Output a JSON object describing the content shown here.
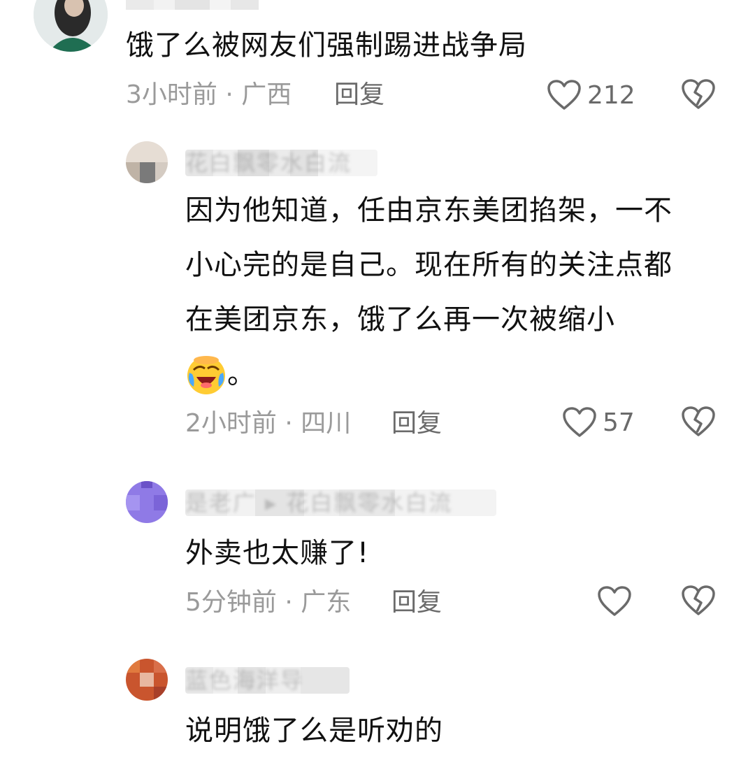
{
  "comments": [
    {
      "text": "饿了么被网友们强制踢进战争局",
      "time": "3小时前",
      "location": "广西",
      "reply_label": "回复",
      "likes": "212"
    },
    {
      "username_blurred": "花白飘零水白流",
      "text_lines": [
        "因为他知道，任由京东美团掐架，一不",
        "小心完的是自己。现在所有的关注点都",
        "在美团京东，饿了么再一次被缩小"
      ],
      "text_tail": "。",
      "emoji": "laughing-crying-emoji",
      "time": "2小时前",
      "location": "四川",
      "reply_label": "回复",
      "likes": "57"
    },
    {
      "username_blurred": "是老广 ▸ 花白飘零水白流",
      "text": "外卖也太赚了!",
      "time": "5分钟前",
      "location": "广东",
      "reply_label": "回复",
      "likes": ""
    },
    {
      "username_blurred": "蓝色海洋导",
      "text": "说明饿了么是听劝的"
    }
  ],
  "separator": " · ",
  "colors": {
    "text": "#111111",
    "meta": "#9a9a9a",
    "icon": "#6a6a6a",
    "background": "#ffffff"
  },
  "icons": {
    "like": "heart-outline-icon",
    "dislike": "broken-heart-icon"
  }
}
